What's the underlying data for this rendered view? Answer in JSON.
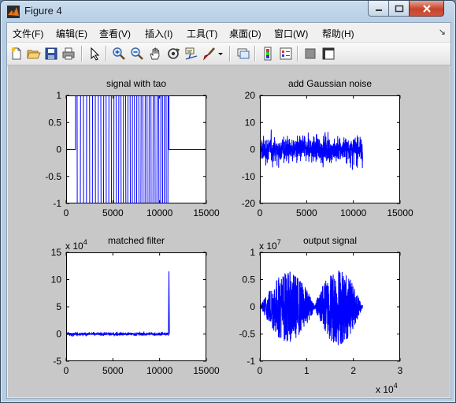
{
  "window": {
    "title": "Figure 4",
    "icon": "matlab-icon",
    "controls": [
      "minimize-icon",
      "maximize-icon",
      "close-icon"
    ]
  },
  "menubar": {
    "items": [
      "文件(F)",
      "编辑(E)",
      "查看(V)",
      "插入(I)",
      "工具(T)",
      "桌面(D)",
      "窗口(W)",
      "帮助(H)"
    ]
  },
  "toolbar": {
    "buttons": [
      "new-figure-icon",
      "open-file-icon",
      "save-icon",
      "print-icon",
      "edit-arrow-icon",
      "zoom-in-icon",
      "zoom-out-icon",
      "pan-hand-icon",
      "rotate-3d-icon",
      "data-cursor-icon",
      "brush-icon",
      "link-plot-icon",
      "colorbar-icon",
      "legend-icon",
      "hide-plot-tools-icon",
      "show-plot-tools-icon"
    ]
  },
  "colors": {
    "line": "#0000ff",
    "figure_bg": "#c8c8c8",
    "axes_bg": "#ffffff"
  },
  "chart_data": [
    {
      "type": "line",
      "title": "signal with tao",
      "xlim": [
        0,
        15000
      ],
      "ylim": [
        -1,
        1
      ],
      "xticks": [
        "0",
        "5000",
        "10000",
        "15000"
      ],
      "yticks": [
        "-1",
        "-0.5",
        "0",
        "0.5",
        "1"
      ],
      "exponent": "",
      "series": [
        {
          "x": [
            0,
            1000,
            1000,
            11000,
            11000,
            15000
          ],
          "y": [
            0,
            0,
            1,
            1,
            0,
            0
          ],
          "description_values": "chirp oscillating between -1 and 1 from x≈1000 to x≈11000, zero elsewhere"
        }
      ]
    },
    {
      "type": "line",
      "title": "add Gaussian noise",
      "xlim": [
        0,
        15000
      ],
      "ylim": [
        -20,
        20
      ],
      "xticks": [
        "0",
        "5000",
        "10000",
        "15000"
      ],
      "yticks": [
        "-20",
        "-10",
        "0",
        "10",
        "20"
      ],
      "exponent": "",
      "series": [
        {
          "x": [
            0,
            11000
          ],
          "y_envelope": [
            -12,
            12
          ]
        }
      ]
    },
    {
      "type": "line",
      "title": "matched filter",
      "xlim": [
        0,
        15000
      ],
      "ylim": [
        -5,
        15
      ],
      "xticks": [
        "0",
        "5000",
        "10000",
        "15000"
      ],
      "yticks": [
        "-5",
        "0",
        "5",
        "10",
        "15"
      ],
      "exponent": "4",
      "series": [
        {
          "x": [
            0,
            10900,
            11000
          ],
          "y": [
            0,
            0,
            11.5
          ]
        }
      ]
    },
    {
      "type": "line",
      "title": "output signal",
      "xlim": [
        0,
        3
      ],
      "ylim": [
        -1,
        1
      ],
      "xticks": [
        "0",
        "1",
        "2",
        "3"
      ],
      "yticks": [
        "-1",
        "-0.5",
        "0",
        "0.5",
        "1"
      ],
      "exponent": "7",
      "x_exponent": "4",
      "series": [
        {
          "x": [
            0,
            0.6,
            1.2,
            1.6,
            2.2
          ],
          "y_envelope": [
            0,
            0.65,
            0.05,
            0.7,
            0
          ]
        }
      ]
    }
  ]
}
